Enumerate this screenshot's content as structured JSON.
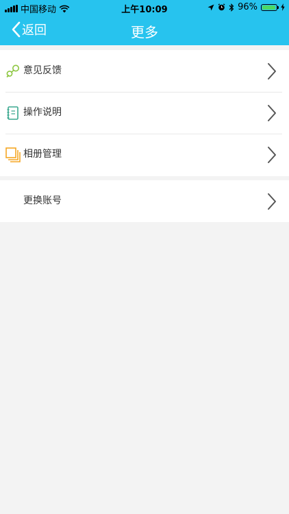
{
  "status_bar": {
    "carrier": "中国移动",
    "time": "上午10:09",
    "battery": "96%",
    "battery_level": 0.96
  },
  "nav": {
    "back_label": "返回",
    "title": "更多"
  },
  "menu_groups": [
    {
      "items": [
        {
          "label": "意见反馈",
          "icon": "feedback-icon"
        },
        {
          "label": "操作说明",
          "icon": "manual-icon"
        },
        {
          "label": "相册管理",
          "icon": "album-icon"
        }
      ]
    },
    {
      "items": [
        {
          "label": "更换账号",
          "icon": ""
        }
      ]
    }
  ],
  "colors": {
    "header": "#27c3ee",
    "background": "#f3f3f3",
    "feedback_icon": "#8cc63f",
    "manual_icon": "#3aa88f",
    "album_icon": "#f5a623",
    "battery": "#4cd964"
  }
}
